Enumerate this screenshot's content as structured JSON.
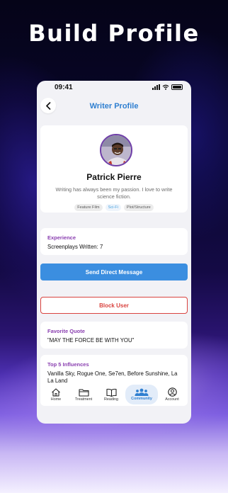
{
  "headline": "Build Profile",
  "status_bar": {
    "time": "09:41"
  },
  "nav": {
    "title": "Writer Profile",
    "back_icon": "chevron-left-icon"
  },
  "profile": {
    "name": "Patrick Pierre",
    "bio": "Writing has always been my passion. I love to write science fiction.",
    "tags": [
      "Feature Film",
      "Sci-Fi",
      "Plot/Structure"
    ]
  },
  "experience": {
    "label": "Experience",
    "value": "Screenplays Written: 7"
  },
  "actions": {
    "message_label": "Send Direct Message",
    "block_label": "Block User"
  },
  "quote": {
    "label": "Favorite Quote",
    "value": "\"MAY THE FORCE BE WITH YOU\""
  },
  "influences": {
    "label": "Top 5 Influences",
    "value": "Vanilla Sky, Rogue One, Se7en, Before Sunshine, La La Land"
  },
  "tabs": [
    {
      "label": "Home",
      "icon": "home-icon"
    },
    {
      "label": "Treatment",
      "icon": "folder-icon"
    },
    {
      "label": "Reading",
      "icon": "book-icon"
    },
    {
      "label": "Community",
      "icon": "people-icon",
      "active": true
    },
    {
      "label": "Account",
      "icon": "account-icon"
    }
  ],
  "colors": {
    "accent": "#2f7fd0",
    "button": "#3b8ee0",
    "danger": "#d9433f",
    "label": "#8a3fb0"
  }
}
